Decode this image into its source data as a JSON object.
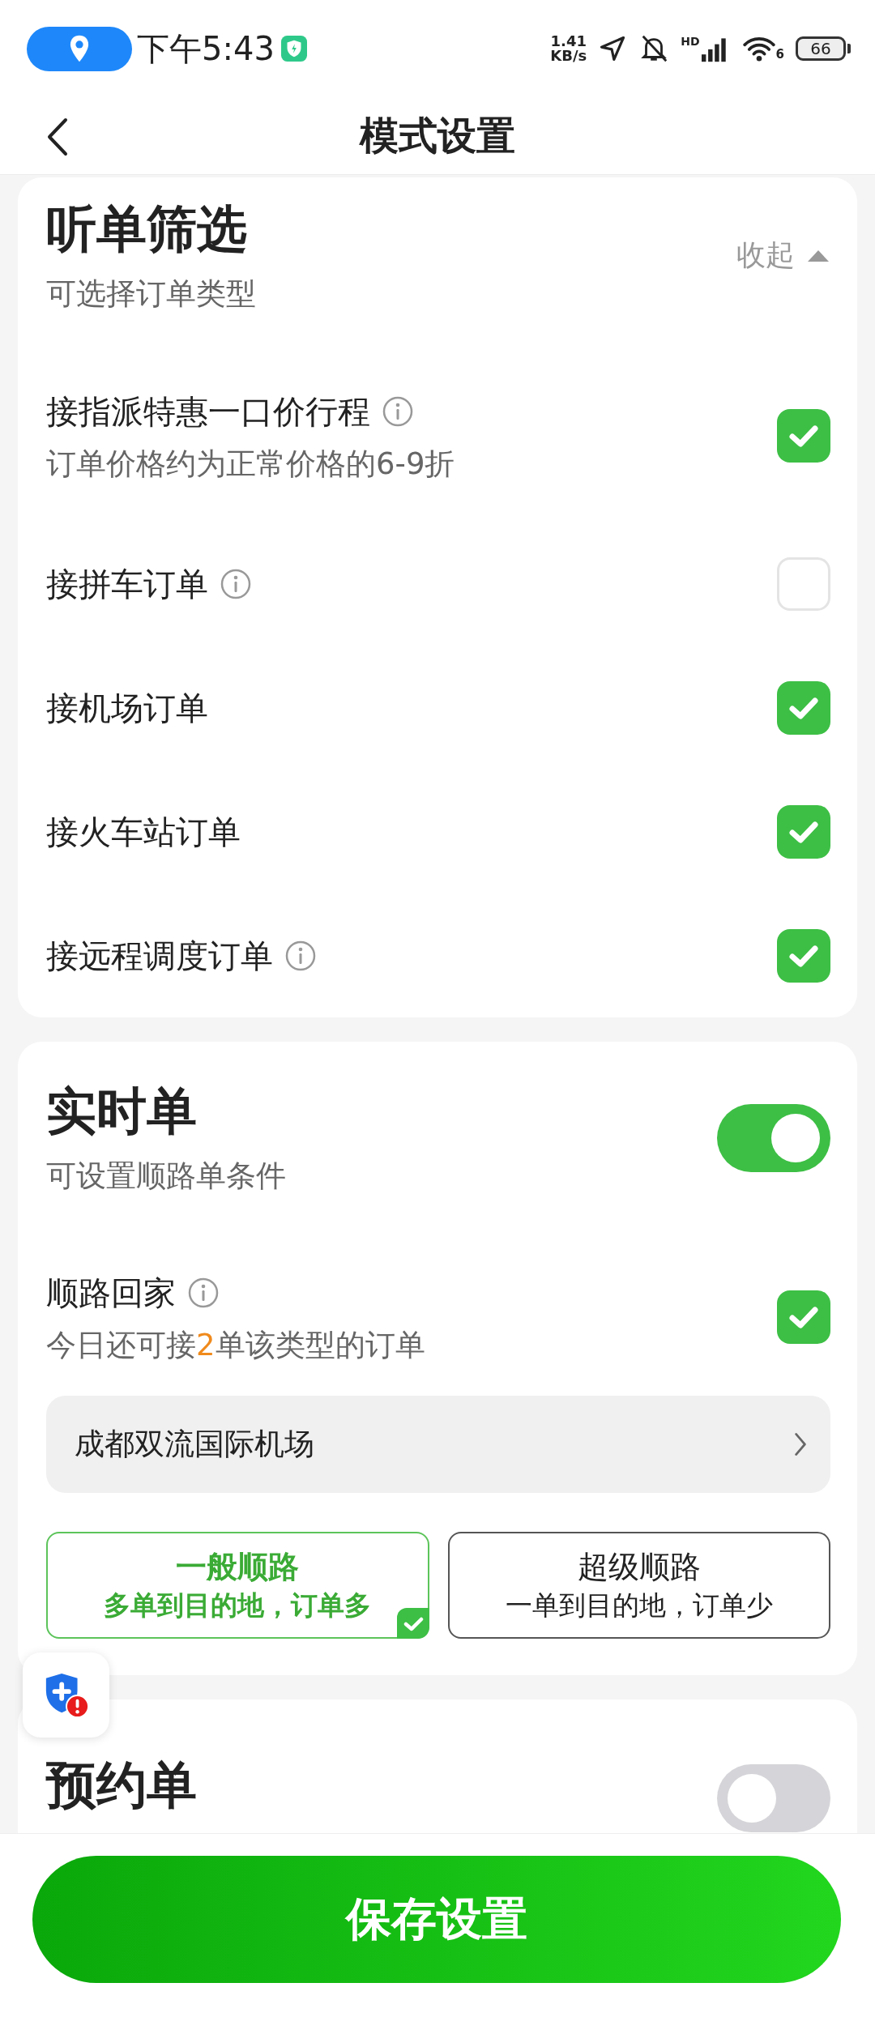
{
  "status_bar": {
    "time": "下午5:43",
    "net_speed_value": "1.41",
    "net_speed_unit": "KB/s",
    "signal_label": "HD",
    "wifi_label": "6",
    "battery": "66"
  },
  "header": {
    "title": "模式设置"
  },
  "filter_section": {
    "title": "听单筛选",
    "subtitle": "可选择订单类型",
    "collapse_label": "收起",
    "expanded": true,
    "items": [
      {
        "label": "接指派特惠一口价行程",
        "note": "订单价格约为正常价格的6-9折",
        "info": true,
        "checked": true
      },
      {
        "label": "接拼车订单",
        "info": true,
        "checked": false
      },
      {
        "label": "接机场订单",
        "info": false,
        "checked": true
      },
      {
        "label": "接火车站订单",
        "info": false,
        "checked": true
      },
      {
        "label": "接远程调度订单",
        "info": true,
        "checked": true
      }
    ]
  },
  "realtime_section": {
    "title": "实时单",
    "subtitle": "可设置顺路单条件",
    "on": true,
    "home": {
      "label": "顺路回家",
      "info": true,
      "checked": true,
      "note_prefix": "今日还可接",
      "count": "2",
      "note_suffix": "单该类型的订单"
    },
    "destination": "成都双流国际机场",
    "modes": [
      {
        "title": "一般顺路",
        "desc": "多单到目的地，订单多",
        "selected": true
      },
      {
        "title": "超级顺路",
        "desc": "一单到目的地，订单少",
        "selected": false
      }
    ]
  },
  "reservation_section": {
    "title": "预约单",
    "on": false
  },
  "save_button": "保存设置"
}
